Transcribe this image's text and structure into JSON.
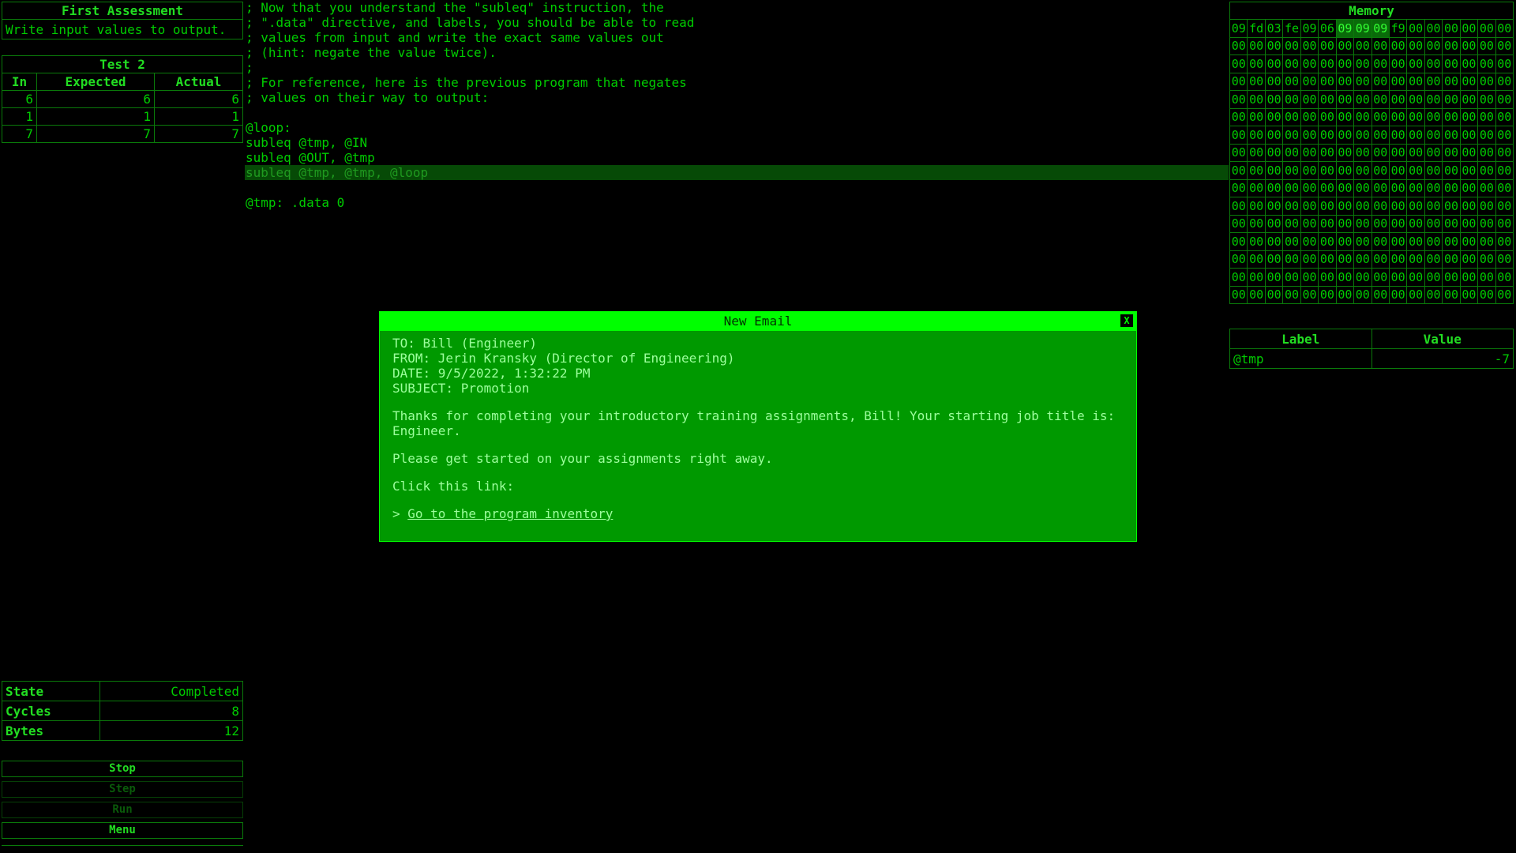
{
  "assessment": {
    "title": "First Assessment",
    "description": "Write input values to output."
  },
  "test": {
    "title": "Test 2",
    "columns": [
      "In",
      "Expected",
      "Actual"
    ],
    "rows": [
      [
        "6",
        "6",
        "6"
      ],
      [
        "1",
        "1",
        "1"
      ],
      [
        "7",
        "7",
        "7"
      ]
    ]
  },
  "status": {
    "state_label": "State",
    "state_value": "Completed",
    "cycles_label": "Cycles",
    "cycles_value": "8",
    "bytes_label": "Bytes",
    "bytes_value": "12"
  },
  "controls": {
    "stop": "Stop",
    "step": "Step",
    "run": "Run",
    "menu": "Menu"
  },
  "code": {
    "lines": [
      "; Now that you understand the \"subleq\" instruction, the",
      "; \".data\" directive, and labels, you should be able to read",
      "; values from input and write the exact same values out",
      "; (hint: negate the value twice).",
      ";",
      "; For reference, here is the previous program that negates",
      "; values on their way to output:",
      "",
      "@loop:",
      "subleq @tmp, @IN",
      "subleq @OUT, @tmp",
      "subleq @tmp, @tmp, @loop",
      "",
      "@tmp: .data 0"
    ],
    "active_line": 11
  },
  "memory": {
    "title": "Memory",
    "first_row": [
      "09",
      "fd",
      "03",
      "fe",
      "09",
      "06",
      "09",
      "09",
      "09",
      "f9",
      "00",
      "00",
      "00",
      "00",
      "00",
      "00"
    ],
    "highlight": [
      6,
      7,
      8
    ],
    "filler": "00",
    "row_count": 16
  },
  "labels": {
    "columns": [
      "Label",
      "Value"
    ],
    "rows": [
      [
        "@tmp",
        "-7"
      ]
    ]
  },
  "email": {
    "title": "New Email",
    "close": "X",
    "to": "TO: Bill (Engineer)",
    "from": "FROM: Jerin Kransky (Director of Engineering)",
    "date": "DATE: 9/5/2022, 1:32:22 PM",
    "subject": "SUBJECT: Promotion",
    "body1": "Thanks for completing your introductory training assignments, Bill! Your starting job title is: Engineer.",
    "body2": "Please get started on your assignments right away.",
    "body3": "Click this link:",
    "link_prefix": "> ",
    "link": "Go to the program inventory"
  },
  "colors": {
    "background": "#000000",
    "text": "#00cc00",
    "dialog_bg": "#009900",
    "dialog_title": "#00ff00"
  }
}
